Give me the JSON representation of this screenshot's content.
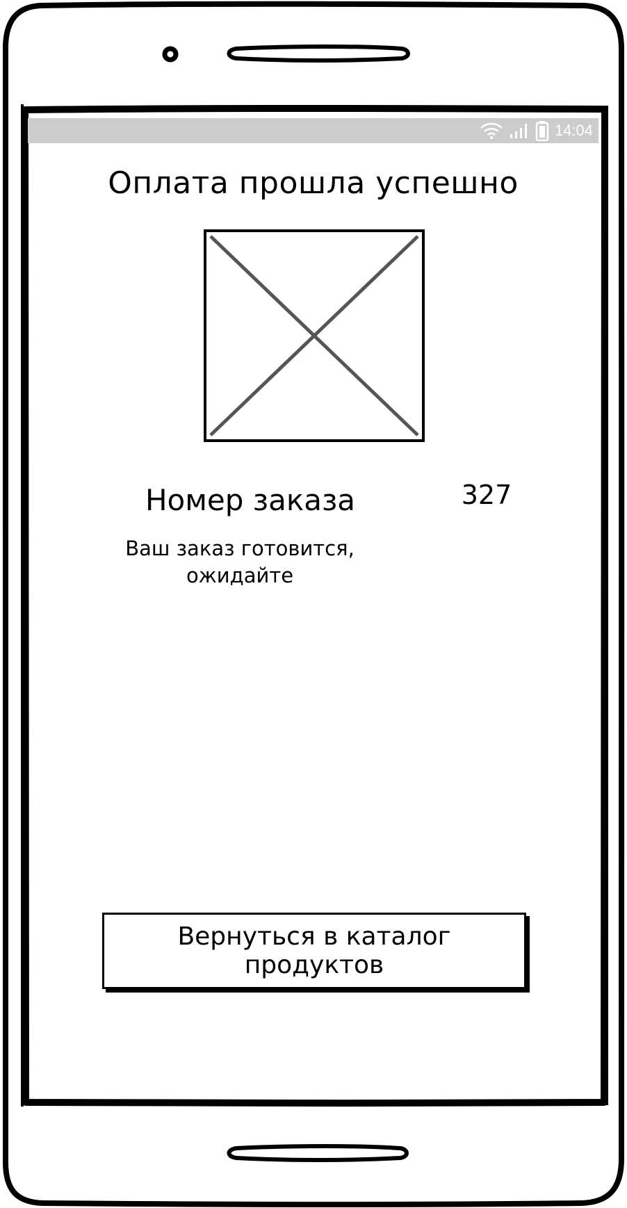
{
  "status_bar": {
    "time": "14:04",
    "wifi_icon": "wifi-icon",
    "signal_icon": "signal-icon",
    "battery_icon": "battery-icon"
  },
  "screen": {
    "title": "Оплата прошла успешно",
    "image_placeholder_icon": "image-placeholder-icon",
    "order_label": "Номер заказа",
    "order_number": "327",
    "order_status_line1": "Ваш заказ готовится,",
    "order_status_line2": "ожидайте",
    "back_button_label": "Вернуться в каталог продуктов"
  },
  "colors": {
    "status_bar": "#cccccc",
    "ink": "#000000",
    "placeholder_cross": "#555555"
  }
}
